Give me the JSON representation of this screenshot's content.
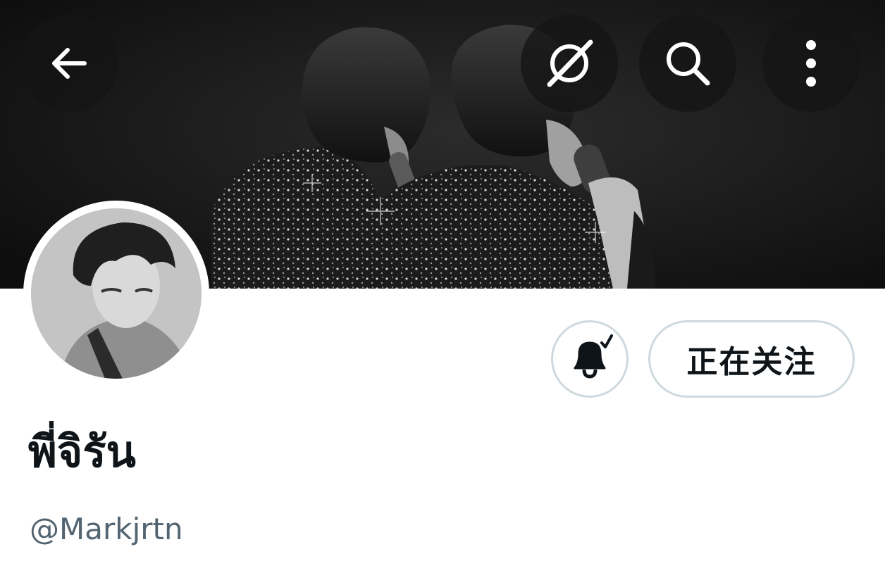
{
  "profile": {
    "display_name": "พี่จิรัน",
    "handle": "@Markjrtn"
  },
  "actions": {
    "follow_label": "正在关注"
  },
  "icons": {
    "back": "arrow-left-icon",
    "grok": "grok-icon",
    "search": "search-icon",
    "more": "more-vertical-icon",
    "notifications": "bell-check-icon"
  },
  "colors": {
    "text_primary": "#0f1419",
    "text_secondary": "#536471",
    "button_border": "#cfd9de",
    "overlay_button": "#141414"
  }
}
